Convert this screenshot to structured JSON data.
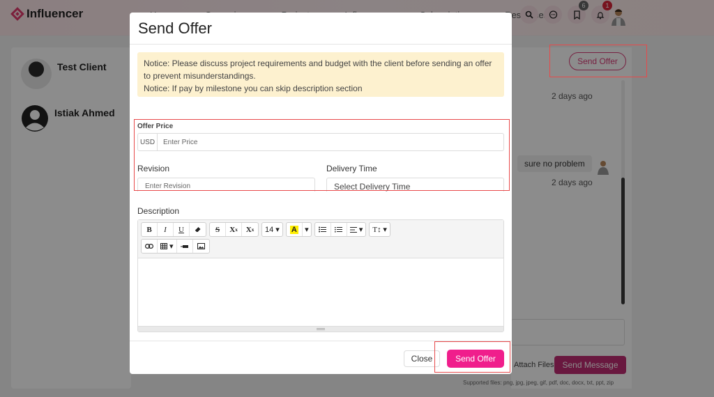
{
  "app": {
    "name": "Influencer"
  },
  "nav": {
    "items": [
      "Home",
      "Campaigns",
      "Projects",
      "Influencers",
      "Subscriptions",
      "Resources"
    ]
  },
  "notifications": {
    "bookmark_count": "6",
    "bell_count": "1"
  },
  "contacts": [
    {
      "name": "Test Client"
    },
    {
      "name": "Istiak Ahmed"
    }
  ],
  "chat": {
    "send_offer_label": "Send Offer",
    "time_1": "2 days ago",
    "message": "sure no problem",
    "time_2": "2 days ago",
    "attach_files_label": "Attach Files",
    "send_message_label": "Send Message",
    "supported_files": "Supported files: png, jpg, jpeg, gif, pdf, doc, docx, txt, ppt, zip"
  },
  "modal": {
    "title": "Send Offer",
    "notice_line_1": "Notice: Please discuss project requirements and budget with the client before sending an offer to prevent misunderstandings.",
    "notice_line_2": "Notice: If pay by milestone you can skip description section",
    "offer_price_label": "Offer Price",
    "currency": "USD",
    "price_placeholder": "Enter Price",
    "revision_label": "Revision",
    "revision_placeholder": "Enter Revision",
    "delivery_label": "Delivery Time",
    "delivery_placeholder": "Select Delivery Time",
    "description_label": "Description",
    "font_size": "14",
    "close_label": "Close",
    "send_label": "Send Offer"
  },
  "colors": {
    "brand": "#e23b6e",
    "send_button": "#f01e8c",
    "send_message": "#c02d73",
    "notice_bg": "#fdf1cf",
    "highlight": "#e8494a"
  }
}
